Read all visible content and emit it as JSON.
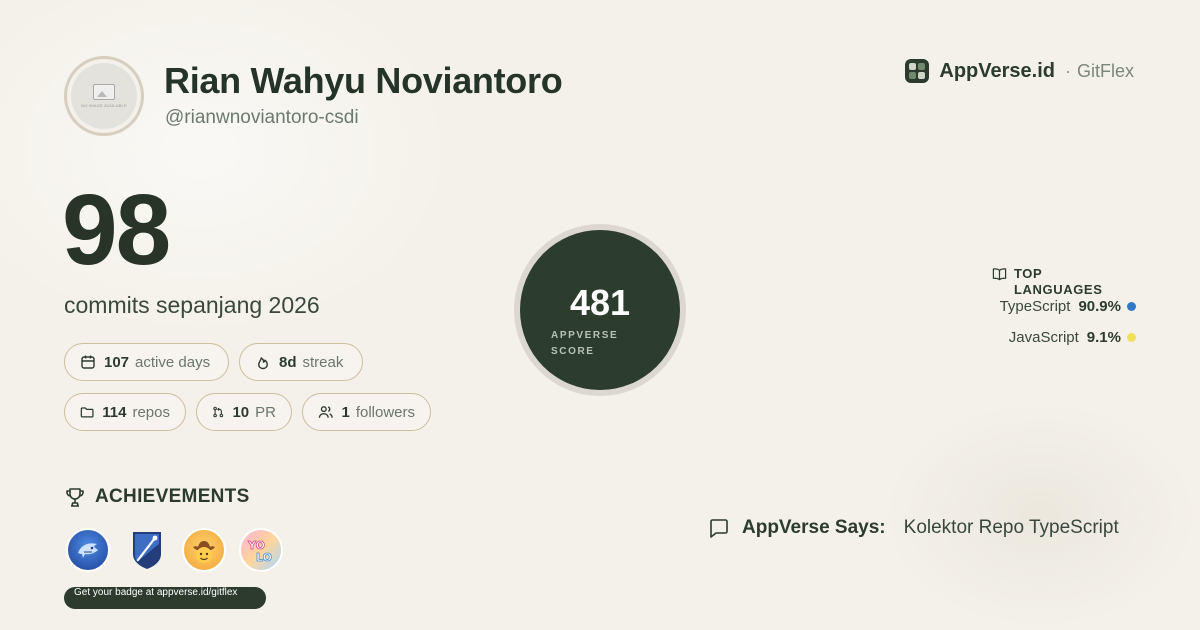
{
  "user": {
    "name": "Rian Wahyu Noviantoro",
    "handle": "@rianwnoviantoro-csdi",
    "avatar_caption": "NO IMAGE AVAILABLE"
  },
  "brand": {
    "name": "AppVerse.id",
    "separator": "·",
    "product": "GitFlex"
  },
  "commits": {
    "count": "98",
    "label": "commits sepanjang 2026"
  },
  "stats": {
    "active_days": {
      "value": "107",
      "label": "active days",
      "icon": "calendar-icon"
    },
    "streak": {
      "value": "8d",
      "label": "streak",
      "icon": "flame-icon"
    },
    "repos": {
      "value": "114",
      "label": "repos",
      "icon": "folder-icon"
    },
    "pr": {
      "value": "10",
      "label": "PR",
      "icon": "git-pull-request-icon"
    },
    "followers": {
      "value": "1",
      "label": "followers",
      "icon": "users-icon"
    }
  },
  "score": {
    "value": "481",
    "label": "APPVERSE SCORE"
  },
  "languages": {
    "title_line1": "TOP",
    "title_line2": "LANGUAGES",
    "items": [
      {
        "name": "TypeScript",
        "percent": "90.9%",
        "color": "#3178c6"
      },
      {
        "name": "JavaScript",
        "percent": "9.1%",
        "color": "#f1e05a"
      }
    ]
  },
  "achievements": {
    "title": "ACHIEVEMENTS",
    "badges": [
      "shark-badge",
      "starstruck-badge",
      "cowboy-badge",
      "yolo-badge"
    ],
    "cta": "Get your badge at appverse.id/gitflex"
  },
  "says": {
    "label": "AppVerse Says:",
    "text": "Kolektor Repo TypeScript"
  },
  "colors": {
    "background": "#f4f1ea",
    "accent_dark": "#2c3d2d",
    "pill_border": "#cdbf9e"
  }
}
